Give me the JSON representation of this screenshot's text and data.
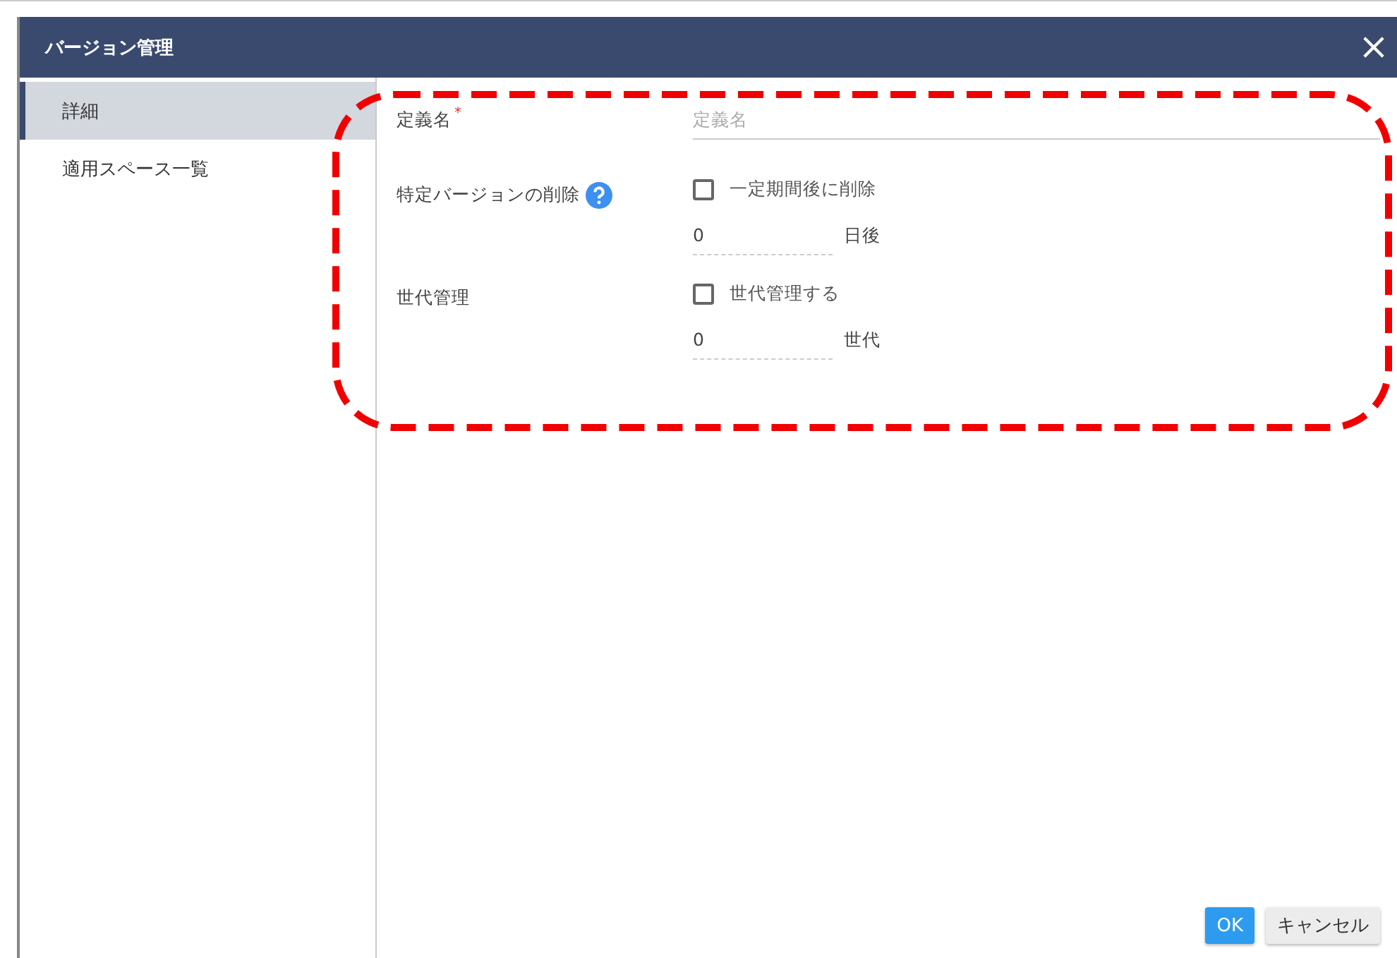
{
  "window": {
    "title": "バージョン管理"
  },
  "sidebar": {
    "items": [
      {
        "label": "詳細",
        "selected": true
      },
      {
        "label": "適用スペース一覧",
        "selected": false
      }
    ]
  },
  "form": {
    "fields": [
      {
        "kind": "text",
        "label": "定義名",
        "required_mark": "*",
        "placeholder": "定義名"
      },
      {
        "kind": "option",
        "label": "特定バージョンの削除",
        "help": true,
        "checkbox": {
          "label": "一定期間後に削除",
          "checked": false
        },
        "number": {
          "value": "0",
          "unit": "日後"
        }
      },
      {
        "kind": "option",
        "label": "世代管理",
        "help": false,
        "checkbox": {
          "label": "世代管理する",
          "checked": false
        },
        "number": {
          "value": "0",
          "unit": "世代"
        }
      }
    ]
  },
  "buttons": [
    {
      "label": "OK",
      "kind": "primary"
    },
    {
      "label": "キャンセル",
      "kind": "secondary"
    }
  ]
}
